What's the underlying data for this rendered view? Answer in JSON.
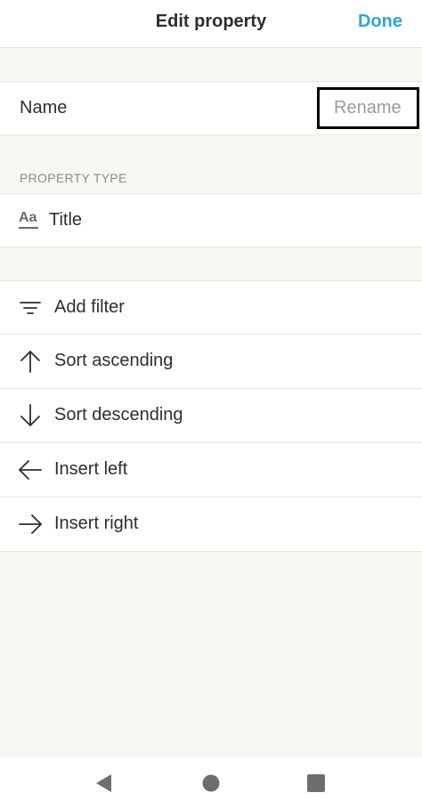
{
  "header": {
    "title": "Edit property",
    "done_label": "Done"
  },
  "name_row": {
    "label": "Name",
    "input_value": "",
    "input_placeholder": "Rename"
  },
  "property_type": {
    "section_label": "PROPERTY TYPE",
    "icon": "text-aa-icon",
    "label": "Title"
  },
  "actions": [
    {
      "label": "Add filter",
      "icon": "filter-icon"
    },
    {
      "label": "Sort ascending",
      "icon": "arrow-up-icon"
    },
    {
      "label": "Sort descending",
      "icon": "arrow-down-icon"
    },
    {
      "label": "Insert left",
      "icon": "arrow-left-icon"
    },
    {
      "label": "Insert right",
      "icon": "arrow-right-icon"
    }
  ],
  "nav_bar": {
    "buttons": [
      "back-icon",
      "home-icon",
      "recents-icon"
    ]
  },
  "colors": {
    "accent": "#2ea4dc",
    "background": "#f7f6f3",
    "text": "#2f2e2b",
    "muted": "#9b9a97"
  }
}
